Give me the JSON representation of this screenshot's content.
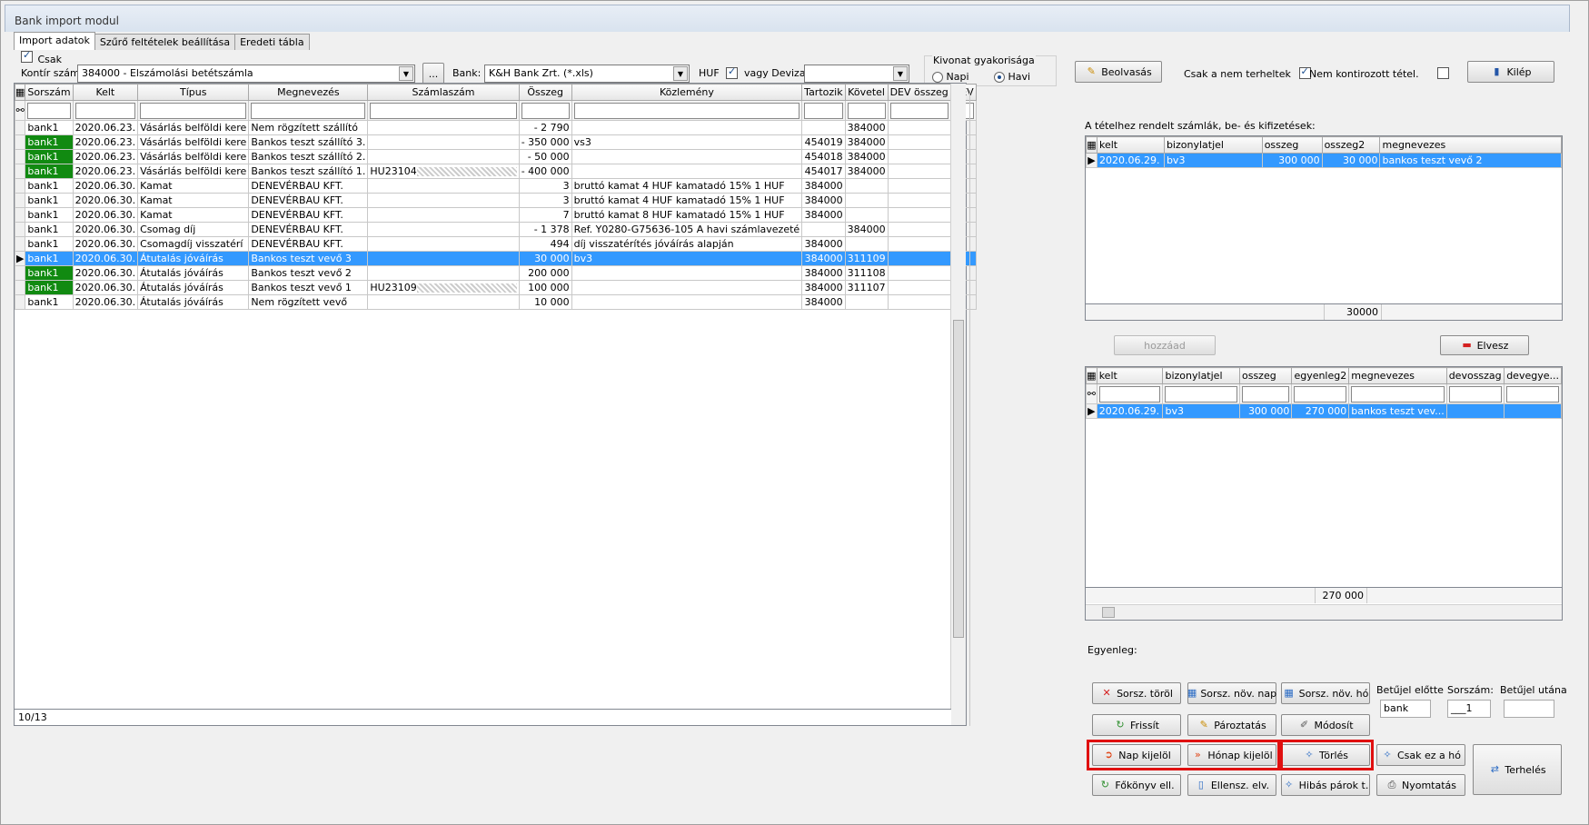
{
  "window": {
    "title": "Bank import modul"
  },
  "tabs": [
    "Import adatok",
    "Szűrő feltételek beállítása",
    "Eredeti tábla"
  ],
  "toolbar": {
    "csak_label": "Csak",
    "kontir_label": "Kontír szám:",
    "kontir_value": "384000 - Elszámolási betétszámla",
    "more_button": "...",
    "bank_label": "Bank:",
    "bank_value": "K&H Bank Zrt. (*.xls)",
    "huf_label": "HUF",
    "deviza_label": "vagy Deviza:",
    "deviza_value": "",
    "kivonat_label": "Kivonat gyakorisága",
    "napi_label": "Napi",
    "havi_label": "Havi",
    "beolvasas_button": "Beolvasás",
    "csak_nem_terheltek_label": "Csak a nem terheltek",
    "nem_kontirozott_label": "Nem kontirozott tétel.",
    "kilep_button": "Kilép"
  },
  "main_grid": {
    "columns": [
      "Sorszám",
      "Kelt",
      "Típus",
      "Megnevezés",
      "Számlaszám",
      "Összeg",
      "Közlemény",
      "Tartozik",
      "Követel",
      "DEV összeg",
      "DEV"
    ],
    "rows": [
      {
        "sorszam": "bank1",
        "kelt": "2020.06.23.",
        "tipus": "Vásárlás belföldi kere",
        "megnevezes": "Nem rögzített szállító",
        "szamla": "",
        "osszeg": "- 2 790",
        "kozlemeny": "",
        "tartozik": "",
        "kovetel": "384000",
        "green": false,
        "hatch": false
      },
      {
        "sorszam": "bank1",
        "kelt": "2020.06.23.",
        "tipus": "Vásárlás belföldi kere",
        "megnevezes": "Bankos teszt szállító 3.",
        "szamla": "",
        "osszeg": "- 350 000",
        "kozlemeny": "vs3",
        "tartozik": "454019",
        "kovetel": "384000",
        "green": true,
        "hatch": false
      },
      {
        "sorszam": "bank1",
        "kelt": "2020.06.23.",
        "tipus": "Vásárlás belföldi kere",
        "megnevezes": "Bankos teszt szállító 2.",
        "szamla": "",
        "osszeg": "- 50 000",
        "kozlemeny": "",
        "tartozik": "454018",
        "kovetel": "384000",
        "green": true,
        "hatch": false
      },
      {
        "sorszam": "bank1",
        "kelt": "2020.06.23.",
        "tipus": "Vásárlás belföldi kere",
        "megnevezes": "Bankos teszt szállító 1.",
        "szamla": "HU23104",
        "osszeg": "- 400 000",
        "kozlemeny": "",
        "tartozik": "454017",
        "kovetel": "384000",
        "green": true,
        "hatch": true
      },
      {
        "sorszam": "bank1",
        "kelt": "2020.06.30.",
        "tipus": "Kamat",
        "megnevezes": "DENEVÉRBAU KFT.",
        "szamla": "",
        "osszeg": "3",
        "kozlemeny": "bruttó kamat 4 HUF kamatadó 15% 1 HUF",
        "tartozik": "384000",
        "kovetel": "",
        "green": false,
        "hatch": false
      },
      {
        "sorszam": "bank1",
        "kelt": "2020.06.30.",
        "tipus": "Kamat",
        "megnevezes": "DENEVÉRBAU KFT.",
        "szamla": "",
        "osszeg": "3",
        "kozlemeny": "bruttó kamat 4 HUF kamatadó 15% 1 HUF",
        "tartozik": "384000",
        "kovetel": "",
        "green": false,
        "hatch": false
      },
      {
        "sorszam": "bank1",
        "kelt": "2020.06.30.",
        "tipus": "Kamat",
        "megnevezes": "DENEVÉRBAU KFT.",
        "szamla": "",
        "osszeg": "7",
        "kozlemeny": "bruttó kamat 8 HUF kamatadó 15% 1 HUF",
        "tartozik": "384000",
        "kovetel": "",
        "green": false,
        "hatch": false
      },
      {
        "sorszam": "bank1",
        "kelt": "2020.06.30.",
        "tipus": "Csomag díj",
        "megnevezes": "DENEVÉRBAU KFT.",
        "szamla": "",
        "osszeg": "- 1 378",
        "kozlemeny": "Ref. Y0280-G75636-105 A havi számlavezeté",
        "tartozik": "",
        "kovetel": "384000",
        "green": false,
        "hatch": false
      },
      {
        "sorszam": "bank1",
        "kelt": "2020.06.30.",
        "tipus": "Csomagdíj visszatérí",
        "megnevezes": "DENEVÉRBAU KFT.",
        "szamla": "",
        "osszeg": "494",
        "kozlemeny": "díj visszatérítés jóváírás alapján",
        "tartozik": "384000",
        "kovetel": "",
        "green": false,
        "hatch": false
      },
      {
        "sorszam": "bank1",
        "kelt": "2020.06.30.",
        "tipus": "Átutalás jóváírás",
        "megnevezes": "Bankos teszt vevő 3",
        "szamla": "",
        "osszeg": "30 000",
        "kozlemeny": "bv3",
        "tartozik": "384000",
        "kovetel": "311109",
        "green": true,
        "hatch": false,
        "selected": true
      },
      {
        "sorszam": "bank1",
        "kelt": "2020.06.30.",
        "tipus": "Átutalás jóváírás",
        "megnevezes": "Bankos teszt vevő 2",
        "szamla": "",
        "osszeg": "200 000",
        "kozlemeny": "",
        "tartozik": "384000",
        "kovetel": "311108",
        "green": true,
        "hatch": false
      },
      {
        "sorszam": "bank1",
        "kelt": "2020.06.30.",
        "tipus": "Átutalás jóváírás",
        "megnevezes": "Bankos teszt vevő 1",
        "szamla": "HU23109",
        "osszeg": "100 000",
        "kozlemeny": "",
        "tartozik": "384000",
        "kovetel": "311107",
        "green": true,
        "hatch": true
      },
      {
        "sorszam": "bank1",
        "kelt": "2020.06.30.",
        "tipus": "Átutalás jóváírás",
        "megnevezes": "Nem rögzített vevő",
        "szamla": "",
        "osszeg": "10 000",
        "kozlemeny": "",
        "tartozik": "384000",
        "kovetel": "",
        "green": false,
        "hatch": false
      }
    ],
    "status": "10/13"
  },
  "right": {
    "assigned_label": "A tételhez rendelt számlák, be- és kifizetések:",
    "top_grid": {
      "columns": [
        "kelt",
        "bizonylatjel",
        "osszeg",
        "osszeg2",
        "megnevezes"
      ],
      "rows": [
        [
          "2020.06.29.",
          "bv3",
          "300 000",
          "30 000",
          "bankos teszt vevő 2"
        ]
      ],
      "footer_total": "30000"
    },
    "hozzaad_button": "hozzáad",
    "elvesz_button": "Elvesz",
    "bottom_grid": {
      "columns": [
        "kelt",
        "bizonylatjel",
        "osszeg",
        "egyenleg2",
        "megnevezes",
        "devosszag",
        "devegye..."
      ],
      "rows": [
        [
          "2020.06.29.",
          "bv3",
          "300 000",
          "270 000",
          "bankos teszt vev...",
          "",
          ""
        ]
      ],
      "footer_total": "270 000"
    },
    "egyenleg_label": "Egyenleg:",
    "buttons": {
      "sorsz_torol": "Sorsz. töröl",
      "sorsz_nov_nap": "Sorsz. növ. nap",
      "sorsz_nov_ho": "Sorsz. növ. hó",
      "frissit": "Frissít",
      "parostatas": "Pároztatás",
      "modosit": "Módosít",
      "nap_kijelol": "Nap kijelöl",
      "honap_kijelol": "Hónap kijelöl",
      "torles": "Törlés",
      "csak_ez_a_ho": "Csak ez a hó",
      "terheles": "Terhelés",
      "fokonyv_ell": "Főkönyv ell.",
      "ellensz_elv": "Ellensz. elv.",
      "hibas_parok": "Hibás párok t.",
      "nyomtatas": "Nyomtatás"
    },
    "betujel_elotte_label": "Betűjel előtte",
    "betujel_elotte_value": "bank",
    "sorszam_label": "Sorszám:",
    "sorszam_value": "___1",
    "betujel_utana_label": "Betűjel utána",
    "betujel_utana_value": ""
  }
}
